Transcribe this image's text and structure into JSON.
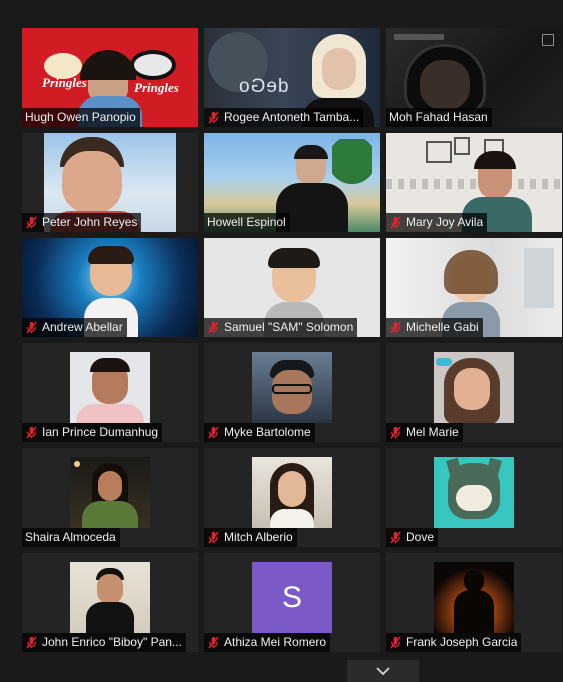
{
  "participants": [
    {
      "name": "Hugh Owen Panopio",
      "muted": false
    },
    {
      "name": "Rogee Antoneth Tamba...",
      "muted": true
    },
    {
      "name": "Moh Fahad Hasan",
      "muted": false
    },
    {
      "name": "Peter John Reyes",
      "muted": true
    },
    {
      "name": "Howell Espinol",
      "muted": false
    },
    {
      "name": "Mary Joy Avila",
      "muted": true
    },
    {
      "name": "Andrew Abellar",
      "muted": true
    },
    {
      "name": "Samuel \"SAM\" Solomon",
      "muted": true
    },
    {
      "name": "Michelle Gabi",
      "muted": true
    },
    {
      "name": "Ian Prince Dumanhug",
      "muted": true
    },
    {
      "name": "Myke Bartolome",
      "muted": true
    },
    {
      "name": "Mel Marie",
      "muted": true
    },
    {
      "name": "Shaira Almoceda",
      "muted": false
    },
    {
      "name": "Mitch Alberio",
      "muted": true
    },
    {
      "name": "Dove",
      "muted": true
    },
    {
      "name": "John Enrico \"Biboy\" Pan...",
      "muted": true
    },
    {
      "name": "Athiza Mei Romero",
      "muted": true
    },
    {
      "name": "Frank Joseph Garcia",
      "muted": true
    }
  ],
  "tile_texts": {
    "pringles_left": "Pringles",
    "pringles_right": "Pringles",
    "code_overlay": "deGo",
    "athiza_initial": "S"
  },
  "colors": {
    "background": "#1a1a1a",
    "tile": "#242424",
    "muted_mic": "#e0242e",
    "athiza_avatar": "#7b59c7"
  },
  "icons": {
    "muted": "microphone-muted-icon",
    "scroll": "chevron-down-icon"
  }
}
